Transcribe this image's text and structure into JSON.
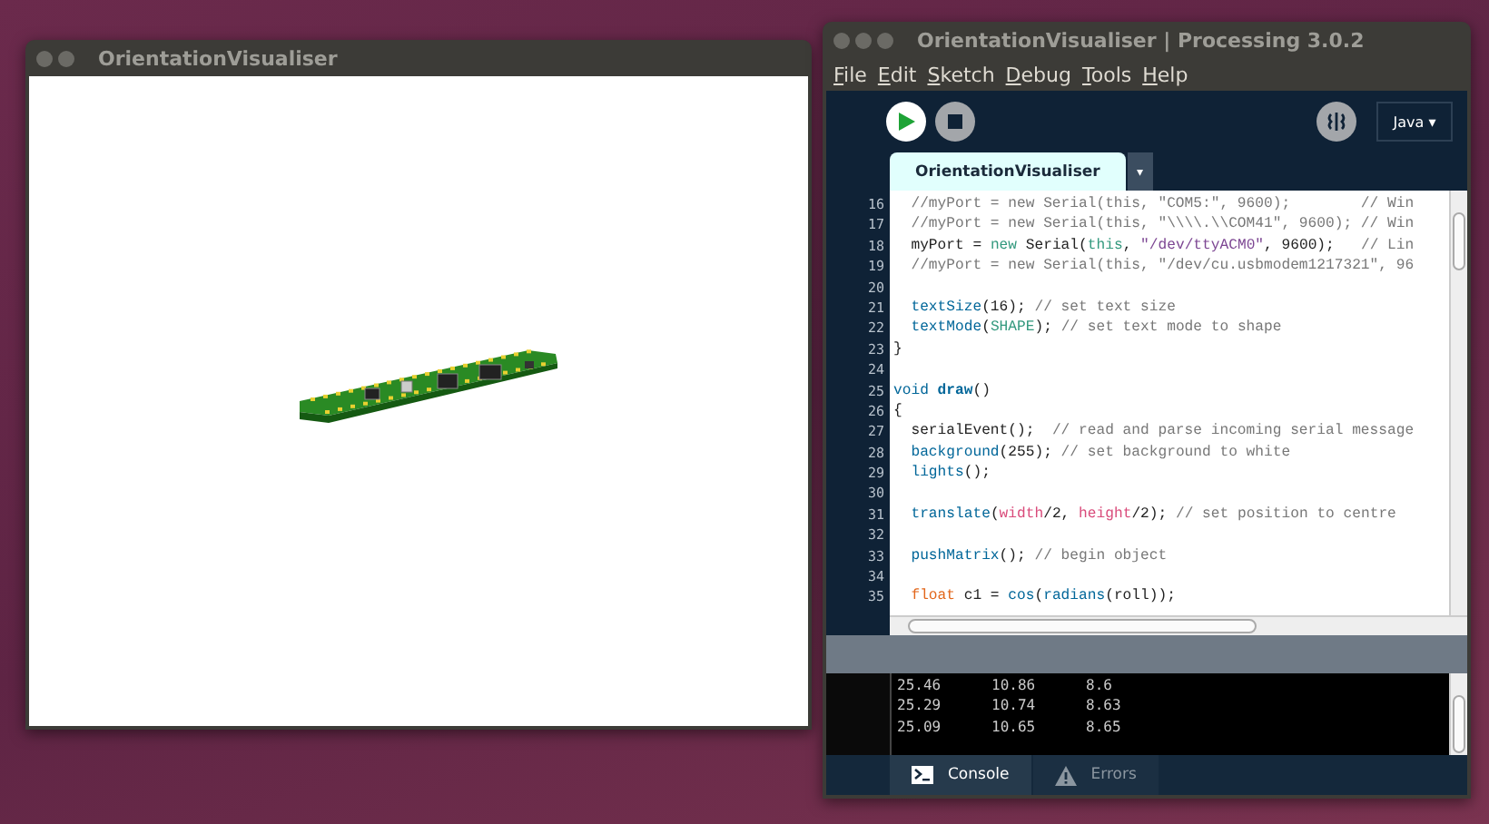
{
  "sketch_window": {
    "title": "OrientationVisualiser"
  },
  "ide_window": {
    "title": "OrientationVisualiser | Processing 3.0.2",
    "menu": [
      "File",
      "Edit",
      "Sketch",
      "Debug",
      "Tools",
      "Help"
    ],
    "mode": "Java ▾",
    "tabs": [
      {
        "label": "OrientationVisualiser",
        "selected": true
      }
    ],
    "tab_menu": "▾",
    "code": [
      {
        "number": "16",
        "tokens": [
          {
            "kind": "comment",
            "t": "  //myPort = new Serial(this, \"COM5:\", 9600);        // Win"
          }
        ]
      },
      {
        "number": "17",
        "tokens": [
          {
            "kind": "comment",
            "t": "  //myPort = new Serial(this, \"\\\\\\\\.\\\\COM41\", 9600); // Win"
          }
        ]
      },
      {
        "number": "18",
        "tokens": [
          {
            "kind": "plain",
            "t": "  myPort = "
          },
          {
            "kind": "keyword",
            "t": "new"
          },
          {
            "kind": "plain",
            "t": " Serial("
          },
          {
            "kind": "keyword",
            "t": "this"
          },
          {
            "kind": "plain",
            "t": ", "
          },
          {
            "kind": "string",
            "t": "\"/dev/ttyACM0\""
          },
          {
            "kind": "plain",
            "t": ", 9600);   "
          },
          {
            "kind": "comment",
            "t": "// Lin"
          }
        ]
      },
      {
        "number": "19",
        "tokens": [
          {
            "kind": "comment",
            "t": "  //myPort = new Serial(this, \"/dev/cu.usbmodem1217321\", 96"
          }
        ]
      },
      {
        "number": "20"
      },
      {
        "number": "21",
        "tokens": [
          {
            "kind": "function",
            "t": "  textSize"
          },
          {
            "kind": "plain",
            "t": "(16); "
          },
          {
            "kind": "comment",
            "t": "// set text size"
          }
        ]
      },
      {
        "number": "22",
        "tokens": [
          {
            "kind": "function",
            "t": "  textMode"
          },
          {
            "kind": "plain",
            "t": "("
          },
          {
            "kind": "keyword",
            "t": "SHAPE"
          },
          {
            "kind": "plain",
            "t": "); "
          },
          {
            "kind": "comment",
            "t": "// set text mode to shape"
          }
        ]
      },
      {
        "number": "23",
        "tokens": [
          {
            "kind": "plain",
            "t": "}"
          }
        ]
      },
      {
        "number": "24"
      },
      {
        "number": "25",
        "tokens": [
          {
            "kind": "function",
            "t": "void "
          },
          {
            "kind": "bold",
            "t": "draw"
          },
          {
            "kind": "plain",
            "t": "()"
          }
        ]
      },
      {
        "number": "26",
        "tokens": [
          {
            "kind": "plain",
            "t": "{"
          }
        ]
      },
      {
        "number": "27",
        "tokens": [
          {
            "kind": "plain",
            "t": "  serialEvent();  "
          },
          {
            "kind": "comment",
            "t": "// read and parse incoming serial message"
          }
        ]
      },
      {
        "number": "28",
        "tokens": [
          {
            "kind": "function",
            "t": "  background"
          },
          {
            "kind": "plain",
            "t": "(255); "
          },
          {
            "kind": "comment",
            "t": "// set background to white"
          }
        ]
      },
      {
        "number": "29",
        "tokens": [
          {
            "kind": "function",
            "t": "  lights"
          },
          {
            "kind": "plain",
            "t": "();"
          }
        ]
      },
      {
        "number": "30"
      },
      {
        "number": "31",
        "tokens": [
          {
            "kind": "function",
            "t": "  translate"
          },
          {
            "kind": "plain",
            "t": "("
          },
          {
            "kind": "constant",
            "t": "width"
          },
          {
            "kind": "plain",
            "t": "/2, "
          },
          {
            "kind": "constant",
            "t": "height"
          },
          {
            "kind": "plain",
            "t": "/2); "
          },
          {
            "kind": "comment",
            "t": "// set position to centre"
          }
        ]
      },
      {
        "number": "32"
      },
      {
        "number": "33",
        "tokens": [
          {
            "kind": "function",
            "t": "  pushMatrix"
          },
          {
            "kind": "plain",
            "t": "(); "
          },
          {
            "kind": "comment",
            "t": "// begin object"
          }
        ]
      },
      {
        "number": "34"
      },
      {
        "number": "35",
        "tokens": [
          {
            "kind": "type",
            "t": "  float"
          },
          {
            "kind": "plain",
            "t": " c1 = "
          },
          {
            "kind": "function",
            "t": "cos"
          },
          {
            "kind": "plain",
            "t": "("
          },
          {
            "kind": "function",
            "t": "radians"
          },
          {
            "kind": "plain",
            "t": "(roll));"
          }
        ]
      }
    ],
    "console": [
      [
        "25.46",
        "10.86",
        "8.6"
      ],
      [
        "25.29",
        "10.74",
        "8.63"
      ],
      [
        "25.09",
        "10.65",
        "8.65"
      ]
    ],
    "console_tabs": [
      {
        "label": "Console",
        "kind": "console",
        "selected": true
      },
      {
        "label": "Errors",
        "kind": "errors",
        "selected": false
      }
    ]
  }
}
